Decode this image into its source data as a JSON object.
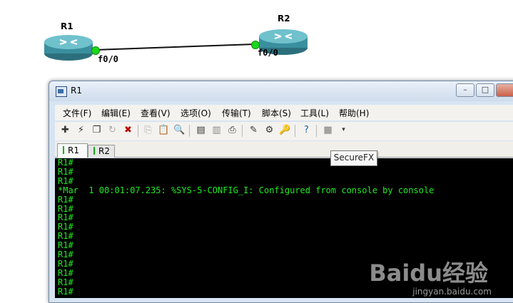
{
  "topology": {
    "routers": [
      {
        "name": "R1"
      },
      {
        "name": "R2"
      }
    ],
    "ports": {
      "r1_port": "f0/0",
      "r2_port": "f0/0"
    },
    "colors": {
      "link": "#111111",
      "port_up": "#1bd61b",
      "router_body": "#3a8f9e"
    }
  },
  "window": {
    "title": "R1",
    "menu": [
      "文件(F)",
      "编辑(E)",
      "查看(V)",
      "选项(O)",
      "传输(T)",
      "脚本(S)",
      "工具(L)",
      "帮助(H)"
    ],
    "tabs": [
      {
        "label": "R1",
        "active": true
      },
      {
        "label": "R2",
        "active": false
      }
    ],
    "tooltip": "SecureFX",
    "caption_buttons": [
      "minimize",
      "maximize",
      "close"
    ]
  },
  "terminal": {
    "lines": [
      "R1#",
      "R1#",
      "R1#",
      "*Mar  1 00:01:07.235: %SYS-5-CONFIG_I: Configured from console by console",
      "R1#",
      "R1#",
      "R1#",
      "R1#",
      "R1#",
      "R1#",
      "R1#",
      "R1#",
      "R1#",
      "R1#",
      "R1#"
    ],
    "colors": {
      "text": "#22e822",
      "background": "#000000"
    }
  },
  "watermark": {
    "brand": "Baidu经验",
    "url": "jingyan.baidu.com"
  }
}
